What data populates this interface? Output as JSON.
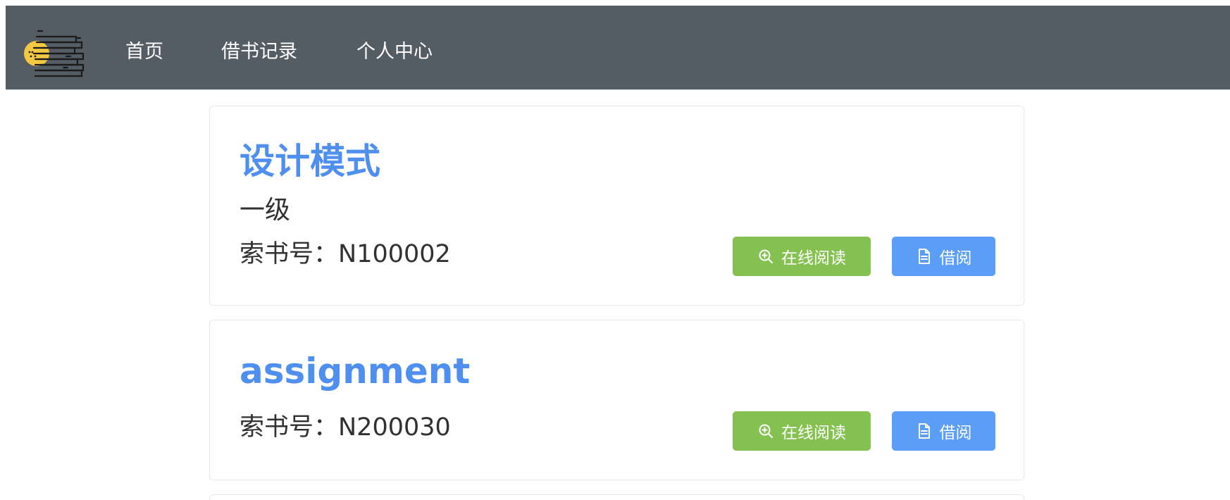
{
  "nav": {
    "items": [
      {
        "label": "首页"
      },
      {
        "label": "借书记录"
      },
      {
        "label": "个人中心"
      }
    ]
  },
  "books": [
    {
      "title": "设计模式",
      "level": "一级",
      "call_label": "索书号：",
      "call_number": "N100002",
      "read_label": "在线阅读",
      "borrow_label": "借阅"
    },
    {
      "title": "assignment",
      "call_label": "索书号：",
      "call_number": "N200030",
      "read_label": "在线阅读",
      "borrow_label": "借阅"
    }
  ],
  "icons": {
    "logo": "books-stack-logo-icon",
    "read": "zoom-in-icon",
    "borrow": "document-icon"
  },
  "colors": {
    "navbar_bg": "#545c64",
    "title": "#4f8ff0",
    "read_button": "#85c151",
    "borrow_button": "#5b9ef8"
  }
}
